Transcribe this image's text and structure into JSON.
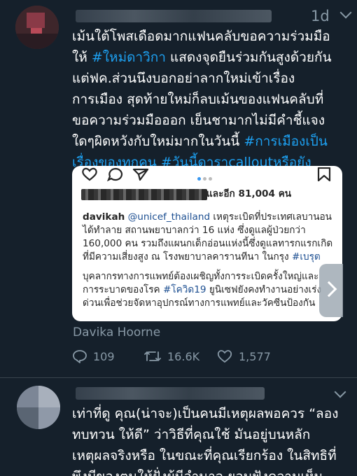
{
  "tweet1": {
    "timestamp": "1d",
    "lines": [
      [
        {
          "t": "เม้นใต้โพสเดือดมากแฟนคลับขอความร่วมมือ",
          "tag": false
        }
      ],
      [
        {
          "t": "ให้ ",
          "tag": false
        },
        {
          "t": "#ใหม่ดาวิกา",
          "tag": true
        },
        {
          "t": " แสดงจุดยืนร่วมกันสูงด้วยกัน",
          "tag": false
        }
      ],
      [
        {
          "t": "แต่ฟค.ส่วนนึงบอกอย่าลากใหม่เข้าเรื่อง",
          "tag": false
        }
      ],
      [
        {
          "t": "การเมือง สุดท้ายใหม่ก็ลบเม้นของแฟนคลับที่",
          "tag": false
        }
      ],
      [
        {
          "t": "ขอความร่วมมือออก เย็นชามากไม่มีคำชี้แจง",
          "tag": false
        }
      ],
      [
        {
          "t": "ใดๆผิดหวังกับใหม่มากในวันนี้ ",
          "tag": false
        },
        {
          "t": "#การเมืองเป็น",
          "tag": true
        }
      ],
      [
        {
          "t": "เรื่องของทุกคน #วันนี้ดาราcalloutหรือยัง",
          "tag": true
        }
      ]
    ],
    "card": {
      "likes_text": "และอีก 81,004 คน",
      "caption": [
        [
          {
            "t": "davikah",
            "c": "bold"
          },
          {
            "t": " @unicef_thailand",
            "c": "blue"
          },
          {
            "t": " เหตุระเบิดที่ประเทศเลบานอน",
            "c": ""
          }
        ],
        [
          {
            "t": "ได้ทำลาย สถานพยาบาลกว่า 16 แห่ง ซึ่งดูแลผู้ป่วยกว่า",
            "c": ""
          }
        ],
        [
          {
            "t": "160,000 คน รวมถึงแผนกเด็กอ่อนแห่งนี้ซึ่งดูแลทารกแรกเกิด",
            "c": ""
          }
        ],
        [
          {
            "t": "ที่มีความเสี่ยงสูง ณ โรงพยาบาลคารานทีนา ในกรุง ",
            "c": ""
          },
          {
            "t": "#เบรุต",
            "c": "blue"
          }
        ],
        [
          {
            "t": "บุคลากรทางการแพทย์ต้องเผชิญทั้งการระเบิดครั้งใหญ่และ",
            "c": ""
          }
        ],
        [
          {
            "t": "การระบาดของโรค ",
            "c": ""
          },
          {
            "t": "#โควิด19",
            "c": "blue"
          },
          {
            "t": " ยูนิเซฟยังคงทำงานอย่างเร่ง",
            "c": ""
          }
        ],
        [
          {
            "t": "ด่วนเพื่อช่วยจัดหาอุปกรณ์ทางการแพทย์และวัคซีนป้องกัน",
            "c": ""
          }
        ]
      ],
      "source": "Davika Hoorne"
    },
    "actions": {
      "replies": "109",
      "retweets": "16.6K",
      "likes": "1,577"
    }
  },
  "tweet2": {
    "lines": [
      [
        {
          "t": "เท่าที่ดู คุณ(น่าจะ)เป็นคนมีเหตุผลพอควร “ลอง",
          "tag": false
        }
      ],
      [
        {
          "t": "ทบทวน ให้ดี” ว่าวิธีที่คุณใช้ มันอยู่บนหลัก",
          "tag": false
        }
      ],
      [
        {
          "t": "เหตุผลจริงหรือ ในขณะที่คุณเรียกร้อง ในสิทธิที่",
          "tag": false
        }
      ],
      [
        {
          "t": "พึงมีของตนให้ฝั่งผู้มีอำนาจ ยอมฟังความเห็น",
          "tag": false
        }
      ]
    ]
  },
  "colors": {
    "background": "#15202b",
    "link": "#1da1f2",
    "muted": "#8899a6"
  },
  "icons": [
    "chevron-down-icon",
    "heart-outline-icon",
    "comment-outline-icon",
    "send-icon",
    "bookmark-icon",
    "reply-icon",
    "retweet-icon",
    "like-icon",
    "next-arrow-icon"
  ]
}
